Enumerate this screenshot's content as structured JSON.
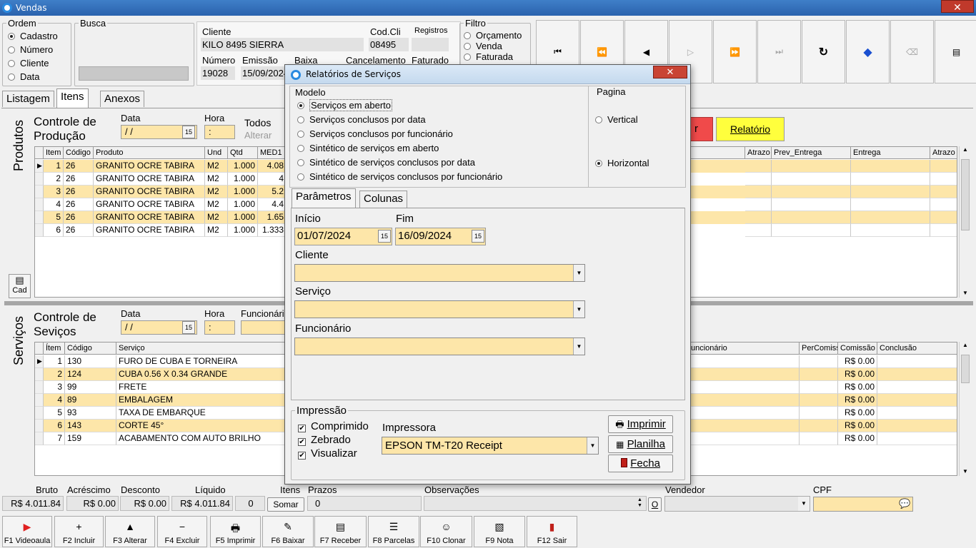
{
  "window": {
    "title": "Vendas",
    "close": "✕"
  },
  "ordem": {
    "legend": "Ordem",
    "options": [
      "Cadastro",
      "Número",
      "Cliente",
      "Data"
    ],
    "selected": 0
  },
  "busca": {
    "legend": "Busca",
    "value": ""
  },
  "cliente": {
    "label": "Cliente",
    "value": "KILO 8495 SIERRA",
    "codcli_label": "Cod.Cli",
    "codcli": "08495",
    "registros_label": "Registros"
  },
  "numero": {
    "label": "Número",
    "value": "19028",
    "emissao_label": "Emissão",
    "emissao": "15/09/2024",
    "baixa_label": "Baixa",
    "cancel_label": "Cancelamento",
    "faturado_label": "Faturado"
  },
  "filtro": {
    "legend": "Filtro",
    "options": [
      "Orçamento",
      "Venda",
      "Faturada"
    ]
  },
  "tabs": [
    "Listagem",
    "Itens",
    "Anexos"
  ],
  "produtos": {
    "side_label": "Produtos",
    "title": "Controle de Produção",
    "data_label": "Data",
    "data_value": "/ /",
    "hora_label": "Hora",
    "hora_value": ":",
    "todos_label": "Todos",
    "alterar_label": "Alterar",
    "cad_label": "Cad",
    "relatorio_label": "Relatório",
    "columns": [
      "Item",
      "Código",
      "Produto",
      "Und",
      "Qtd",
      "MED1"
    ],
    "right_columns": [
      "Atrazo",
      "Prev_Entrega",
      "Entrega",
      "Atrazo"
    ],
    "rows": [
      [
        "1",
        "26",
        "GRANITO OCRE TABIRA",
        "M2",
        "1.000",
        "4.08"
      ],
      [
        "2",
        "26",
        "GRANITO OCRE TABIRA",
        "M2",
        "1.000",
        "4"
      ],
      [
        "3",
        "26",
        "GRANITO OCRE TABIRA",
        "M2",
        "1.000",
        "5.2"
      ],
      [
        "4",
        "26",
        "GRANITO OCRE TABIRA",
        "M2",
        "1.000",
        "4.4"
      ],
      [
        "5",
        "26",
        "GRANITO OCRE TABIRA",
        "M2",
        "1.000",
        "1.65"
      ],
      [
        "6",
        "26",
        "GRANITO OCRE TABIRA",
        "M2",
        "1.000",
        "1.333"
      ]
    ]
  },
  "servicos": {
    "side_label": "Serviços",
    "title": "Controle de Seviços",
    "data_label": "Data",
    "data_value": "/ /",
    "hora_label": "Hora",
    "hora_value": ":",
    "func_label": "Funcionári",
    "columns": [
      "Ítem",
      "Código",
      "Serviço"
    ],
    "right_columns": [
      "uncionário",
      "PerComiss",
      "Comissão",
      "Conclusão"
    ],
    "rows": [
      [
        "1",
        "130",
        "FURO DE CUBA E TORNEIRA",
        "R$ 0.00"
      ],
      [
        "2",
        "124",
        "CUBA 0.56 X 0.34 GRANDE",
        "R$ 0.00"
      ],
      [
        "3",
        "99",
        "FRETE",
        "R$ 0.00"
      ],
      [
        "4",
        "89",
        "EMBALAGEM",
        "R$ 0.00"
      ],
      [
        "5",
        "93",
        "TAXA DE EMBARQUE",
        "R$ 0.00"
      ],
      [
        "6",
        "143",
        "CORTE 45°",
        "R$ 0.00"
      ],
      [
        "7",
        "159",
        "ACABAMENTO COM AUTO BRILHO",
        "R$ 0.00"
      ]
    ]
  },
  "totals": {
    "bruto_label": "Bruto",
    "bruto": "R$ 4.011.84",
    "acrescimo_label": "Acréscimo",
    "acrescimo": "R$ 0.00",
    "desconto_label": "Desconto",
    "desconto": "R$ 0.00",
    "liquido_label": "Líquido",
    "liquido": "R$ 4.011.84",
    "itens_label": "Itens",
    "itens": "0",
    "somar_label": "Somar",
    "prazos_label": "Prazos",
    "prazos": "0",
    "obs_label": "Observações",
    "o_label": "O",
    "vendedor_label": "Vendedor",
    "cpf_label": "CPF"
  },
  "fkeys": [
    {
      "label": "F1 Videoaula",
      "icon": "video-icon"
    },
    {
      "label": "F2 Incluir",
      "icon": "plus-icon"
    },
    {
      "label": "F3 Alterar",
      "icon": "arrow-up-icon"
    },
    {
      "label": "F4 Excluir",
      "icon": "minus-icon"
    },
    {
      "label": "F5 Imprimir",
      "icon": "printer-icon"
    },
    {
      "label": "F6 Baixar",
      "icon": "check-doc-icon"
    },
    {
      "label": "F7 Receber",
      "icon": "register-icon"
    },
    {
      "label": "F8 Parcelas",
      "icon": "list-icon"
    },
    {
      "label": "F10 Clonar",
      "icon": "sheep-icon"
    },
    {
      "label": "F9 Nota",
      "icon": "note-icon"
    },
    {
      "label": "F12 Sair",
      "icon": "exit-door-icon"
    }
  ],
  "dialog": {
    "title": "Relatórios de Serviços",
    "close": "✕",
    "modelo_legend": "Modelo",
    "modelo_options": [
      "Serviços em aberto",
      "Serviços conclusos por data",
      "Serviços conclusos por funcionário",
      "Sintético de serviços em aberto",
      "Sintético de serviços conclusos por data",
      "Sintético de serviços conclusos por funcionário"
    ],
    "modelo_selected": 0,
    "pagina_legend": "Pagina",
    "pagina_options": [
      "Vertical",
      "Horizontal"
    ],
    "pagina_selected": 1,
    "tabs": [
      "Parâmetros",
      "Colunas"
    ],
    "inicio_label": "Início",
    "inicio": "01/07/2024",
    "fim_label": "Fim",
    "fim": "16/09/2024",
    "cliente_label": "Cliente",
    "cliente": "",
    "servico_label": "Serviço",
    "servico": "",
    "funcionario_label": "Funcionário",
    "funcionario": "",
    "impressao_legend": "Impressão",
    "checks": [
      "Comprimido",
      "Zebrado",
      "Visualizar"
    ],
    "impressora_label": "Impressora",
    "impressora": "EPSON TM-T20 Receipt",
    "imprimir": "Imprimir",
    "planilha": "Planilha",
    "fecha": "Fecha"
  }
}
